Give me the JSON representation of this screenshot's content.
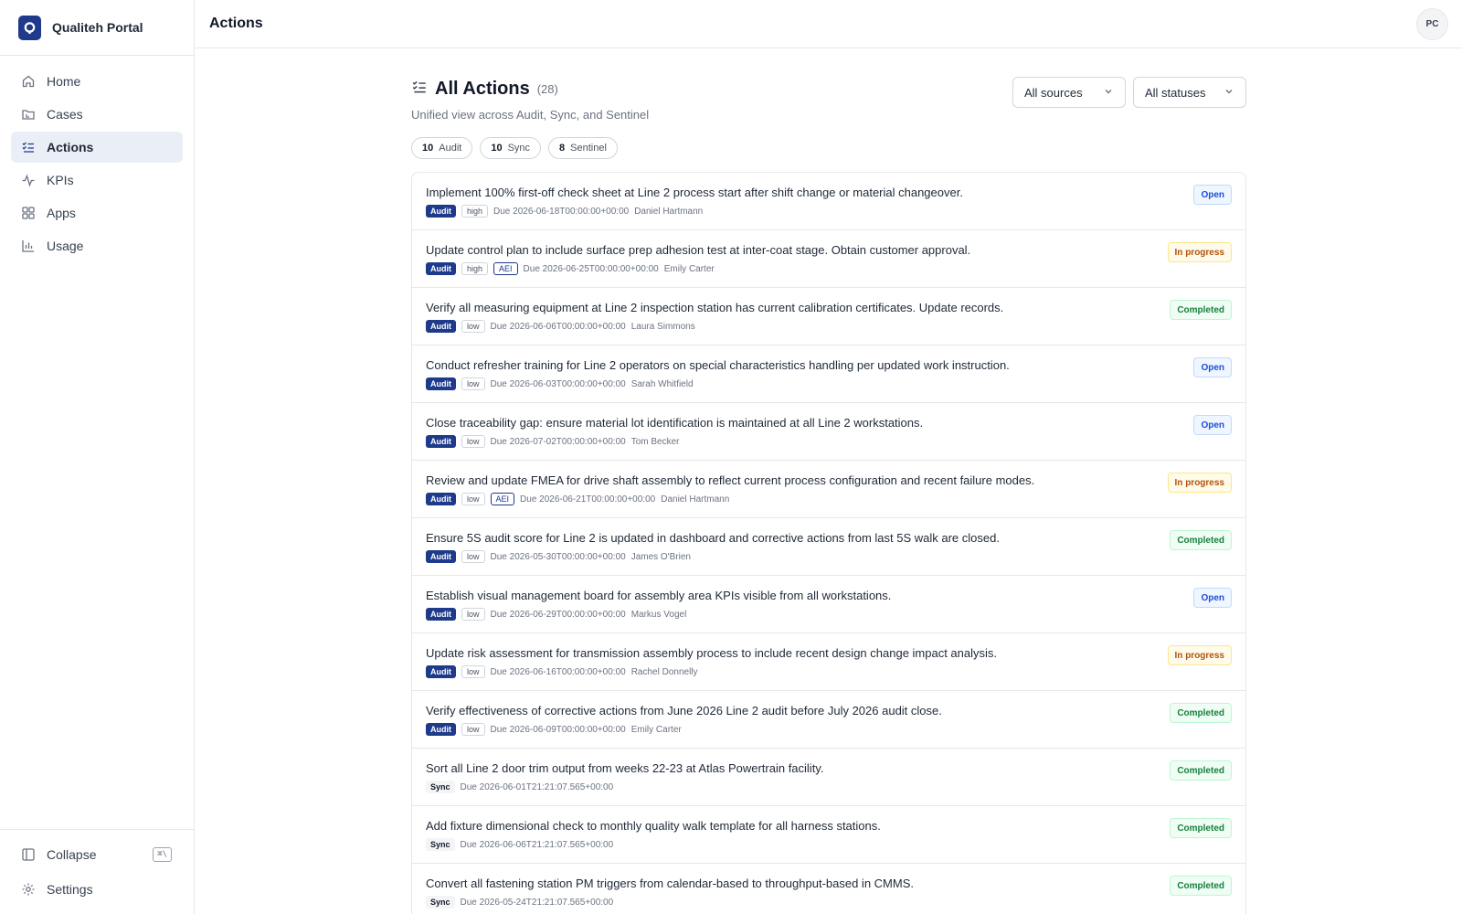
{
  "app": {
    "name": "Qualiteh Portal"
  },
  "sidebar": {
    "items": [
      {
        "label": "Home",
        "icon": "home-icon",
        "active": false
      },
      {
        "label": "Cases",
        "icon": "folder-icon",
        "active": false
      },
      {
        "label": "Actions",
        "icon": "list-check-icon",
        "active": true
      },
      {
        "label": "KPIs",
        "icon": "activity-icon",
        "active": false
      },
      {
        "label": "Apps",
        "icon": "grid-icon",
        "active": false
      },
      {
        "label": "Usage",
        "icon": "bar-chart-icon",
        "active": false
      }
    ],
    "collapse_label": "Collapse",
    "collapse_shortcut": "⌘\\",
    "settings_label": "Settings"
  },
  "header": {
    "title": "Actions",
    "avatar_initials": "PC"
  },
  "main": {
    "title": "All Actions",
    "count": "(28)",
    "subtitle": "Unified view across Audit, Sync, and Sentinel",
    "filters": {
      "sources": "All sources",
      "statuses": "All statuses"
    },
    "chips": [
      {
        "count": "10",
        "label": "Audit"
      },
      {
        "count": "10",
        "label": "Sync"
      },
      {
        "count": "8",
        "label": "Sentinel"
      }
    ],
    "actions": [
      {
        "title": "Implement 100% first-off check sheet at Line 2 process start after shift change or material changeover.",
        "source": "Audit",
        "priority": "high",
        "aei": "",
        "due": "Due 2026-06-18T00:00:00+00:00",
        "owner": "Daniel Hartmann",
        "status": "Open"
      },
      {
        "title": "Update control plan to include surface prep adhesion test at inter-coat stage. Obtain customer approval.",
        "source": "Audit",
        "priority": "high",
        "aei": "AEI",
        "due": "Due 2026-06-25T00:00:00+00:00",
        "owner": "Emily Carter",
        "status": "In progress"
      },
      {
        "title": "Verify all measuring equipment at Line 2 inspection station has current calibration certificates. Update records.",
        "source": "Audit",
        "priority": "low",
        "aei": "",
        "due": "Due 2026-06-06T00:00:00+00:00",
        "owner": "Laura Simmons",
        "status": "Completed"
      },
      {
        "title": "Conduct refresher training for Line 2 operators on special characteristics handling per updated work instruction.",
        "source": "Audit",
        "priority": "low",
        "aei": "",
        "due": "Due 2026-06-03T00:00:00+00:00",
        "owner": "Sarah Whitfield",
        "status": "Open"
      },
      {
        "title": "Close traceability gap: ensure material lot identification is maintained at all Line 2 workstations.",
        "source": "Audit",
        "priority": "low",
        "aei": "",
        "due": "Due 2026-07-02T00:00:00+00:00",
        "owner": "Tom Becker",
        "status": "Open"
      },
      {
        "title": "Review and update FMEA for drive shaft assembly to reflect current process configuration and recent failure modes.",
        "source": "Audit",
        "priority": "low",
        "aei": "AEI",
        "due": "Due 2026-06-21T00:00:00+00:00",
        "owner": "Daniel Hartmann",
        "status": "In progress"
      },
      {
        "title": "Ensure 5S audit score for Line 2 is updated in dashboard and corrective actions from last 5S walk are closed.",
        "source": "Audit",
        "priority": "low",
        "aei": "",
        "due": "Due 2026-05-30T00:00:00+00:00",
        "owner": "James O'Brien",
        "status": "Completed"
      },
      {
        "title": "Establish visual management board for assembly area KPIs visible from all workstations.",
        "source": "Audit",
        "priority": "low",
        "aei": "",
        "due": "Due 2026-06-29T00:00:00+00:00",
        "owner": "Markus Vogel",
        "status": "Open"
      },
      {
        "title": "Update risk assessment for transmission assembly process to include recent design change impact analysis.",
        "source": "Audit",
        "priority": "low",
        "aei": "",
        "due": "Due 2026-06-16T00:00:00+00:00",
        "owner": "Rachel Donnelly",
        "status": "In progress"
      },
      {
        "title": "Verify effectiveness of corrective actions from June 2026 Line 2 audit before July 2026 audit close.",
        "source": "Audit",
        "priority": "low",
        "aei": "",
        "due": "Due 2026-06-09T00:00:00+00:00",
        "owner": "Emily Carter",
        "status": "Completed"
      },
      {
        "title": "Sort all Line 2 door trim output from weeks 22-23 at Atlas Powertrain facility.",
        "source": "Sync",
        "priority": "",
        "aei": "",
        "due": "Due 2026-06-01T21:21:07.565+00:00",
        "owner": "",
        "status": "Completed"
      },
      {
        "title": "Add fixture dimensional check to monthly quality walk template for all harness stations.",
        "source": "Sync",
        "priority": "",
        "aei": "",
        "due": "Due 2026-06-06T21:21:07.565+00:00",
        "owner": "",
        "status": "Completed"
      },
      {
        "title": "Convert all fastening station PM triggers from calendar-based to throughput-based in CMMS.",
        "source": "Sync",
        "priority": "",
        "aei": "",
        "due": "Due 2026-05-24T21:21:07.565+00:00",
        "owner": "",
        "status": "Completed"
      }
    ]
  },
  "colors": {
    "brand": "#1e3a8a",
    "open": "#1d4ed8",
    "in_progress": "#b45309",
    "completed": "#15803d"
  }
}
